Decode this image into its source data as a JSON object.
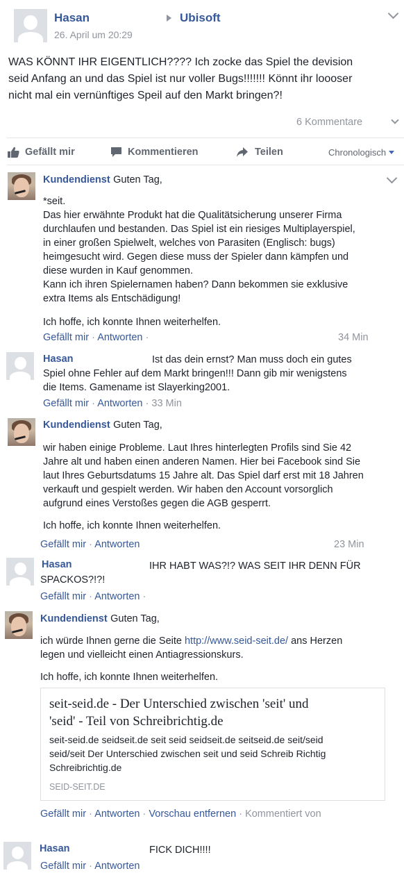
{
  "post": {
    "author": "Hasan",
    "target": "Ubisoft",
    "date": "26. April um 20:29",
    "text_lines": [
      "WAS KÖNNT IHR EIGENTLICH???? Ich zocke das Spiel the devision",
      "seid Anfang an und das Spiel ist nur voller Bugs!!!!!!! Könnt ihr loooser",
      "nicht mal ein vernünftiges Speil auf den Markt bringen?!"
    ],
    "comment_count": "6 Kommentare"
  },
  "actions": {
    "like": "Gefällt mir",
    "comment": "Kommentieren",
    "share": "Teilen",
    "sort": "Chronologisch"
  },
  "common": {
    "like": "Gefällt mir",
    "reply": "Antworten",
    "sep": "·"
  },
  "comments": [
    {
      "author": "Kundendienst",
      "first": "Guten Tag,",
      "lines": [
        "*seit.",
        "Das hier erwähnte Produkt hat die Qualitätsicherung unserer Firma",
        "durchlaufen und bestanden. Das Spiel ist ein riesiges Multiplayerspiel,",
        "in einer großen Spielwelt, welches von Parasiten (Englisch: bugs)",
        "heimgesucht wird. Gegen diese muss der Spieler dann kämpfen und",
        "diese wurden in Kauf genommen.",
        "Kann ich ihren Spielernamen haben? Dann bekommen sie exklusive",
        "extra Items als Entschädigung!"
      ],
      "closing": "Ich hoffe, ich konnte Ihnen weiterhelfen.",
      "time": "34 Min"
    },
    {
      "author": "Hasan",
      "first": "Ist das dein ernst? Man muss doch ein gutes",
      "lines": [
        "Spiel ohne Fehler auf dem Markt bringen!!! Dann gib mir wenigstens",
        "die Items. Gamename ist Slayerking2001."
      ],
      "time": "33 Min"
    },
    {
      "author": "Kundendienst",
      "first": "Guten Tag,",
      "lines": [
        "wir haben einige Probleme. Laut Ihres hinterlegten Profils sind Sie 42",
        "Jahre alt und haben einen anderen Namen. Hier bei Facebook sind Sie",
        "laut Ihres Geburtsdatums 15 Jahre alt. Das Spiel darf erst mit 18 Jahren",
        "verkauft und gespielt werden. Wir haben den Account vorsorglich",
        "aufgrund eines Verstoßes gegen die AGB gesperrt."
      ],
      "closing": "Ich hoffe, ich konnte Ihnen weiterhelfen.",
      "time": "23 Min"
    },
    {
      "author": "Hasan",
      "first": "IHR HABT WAS?!? WAS SEIT IHR DENN FÜR",
      "lines": [
        "SPACKOS?!?!"
      ]
    },
    {
      "author": "Kundendienst",
      "first": "Guten Tag,",
      "line_a": "ich würde Ihnen gerne die Seite",
      "url": "http://www.seid-seit.de/",
      "line_b": "ans Herzen",
      "line_c": "legen und vielleicht einen Antiagressionskurs.",
      "closing": "Ich hoffe, ich konnte Ihnen weiterhelfen.",
      "preview": {
        "title_1": "seit-seid.de - Der Unterschied zwischen 'seit' und",
        "title_2": "'seid' - Teil von Schreibrichtig.de",
        "desc_1": "seit-seid.de seidseit.de seit seid seidseit.de seitseid.de seit/seid",
        "desc_2": "seid/seit Der Unterschied zwischen seit und seid Schreib Richtig",
        "desc_3": "Schreibrichtig.de",
        "domain": "SEID-SEIT.DE"
      },
      "remove_preview": "Vorschau entfernen",
      "commented_by": "Kommentiert von"
    },
    {
      "author": "Hasan",
      "first": "FICK DICH!!!!"
    }
  ]
}
